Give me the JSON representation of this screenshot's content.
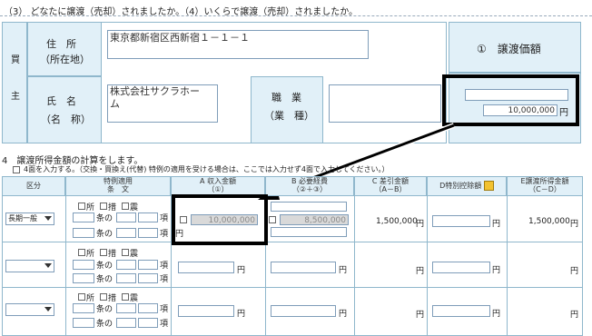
{
  "top_heading": "（3） どなたに譲渡（売却）されましたか。（4）いくらで譲渡（売却）されましたか。",
  "buyer": {
    "label_top": "買",
    "label_bottom": "主",
    "address_label_1": "住　所",
    "address_label_2": "（所在地）",
    "address_value": "東京都新宿区西新宿１－１－１",
    "name_label_1": "氏　名",
    "name_label_2": "（名　称）",
    "name_value_1": "株式会社サクラホー",
    "name_value_2": "ム",
    "occupation_label_1": "職　業",
    "occupation_label_2": "（業　種）",
    "occupation_value": ""
  },
  "price": {
    "header": "①　譲渡価額",
    "value_blank": "",
    "value": "10,000,000",
    "unit": "円"
  },
  "section4": {
    "title": "4　譲渡所得金額の計算をします。",
    "note": "4面を入力する。（交換・買換え(代替) 特例の適用を受ける場合は、ここでは入力せず4面で入力してください。）",
    "headers": {
      "kubun": "区分",
      "tokurei_1": "特例適用",
      "tokurei_2": "条　文",
      "a_1": "A 収入金額",
      "a_2": "（①）",
      "b_1": "B 必要経費",
      "b_2": "（②＋③）",
      "c_1": "C 差引金額",
      "c_2": "（A－B）",
      "d": "D特別控除額",
      "e_1": "E譲渡所得金額",
      "e_2": "（C－D）"
    },
    "checks": {
      "sho": "所",
      "so": "措",
      "shin": "震"
    },
    "jo_no": "条の",
    "ko": "項",
    "yen": "円",
    "rows": [
      {
        "kubun": "長期一般",
        "a": "10,000,000",
        "b": "8,500,000",
        "c": "1,500,000",
        "d": "",
        "e": "1,500,000"
      },
      {
        "kubun": "",
        "a": "",
        "b": "",
        "c": "",
        "d": "",
        "e": ""
      },
      {
        "kubun": "",
        "a": "",
        "b": "",
        "c": "",
        "d": "",
        "e": ""
      }
    ]
  }
}
